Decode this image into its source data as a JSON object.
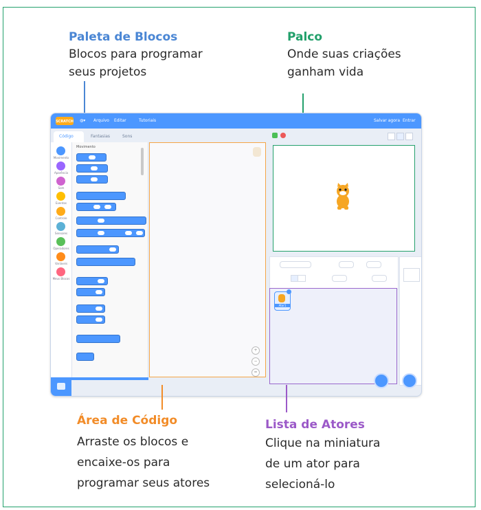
{
  "annotations": {
    "palette": {
      "title": "Paleta de Blocos",
      "desc_1": "Blocos para programar",
      "desc_2": "seus projetos",
      "color": "#4a86d4"
    },
    "stage": {
      "title": "Palco",
      "desc_1": "Onde suas criações",
      "desc_2": "ganham vida",
      "color": "#22a06b"
    },
    "code": {
      "title": "Área de Código",
      "desc_1": "Arraste os blocos e",
      "desc_2": "encaixe-os para",
      "desc_3": "programar seus atores",
      "color": "#f28c28"
    },
    "sprites": {
      "title": "Lista de Atores",
      "desc_1": "Clique na miniatura",
      "desc_2": "de um ator para",
      "desc_3": "selecioná-lo",
      "color": "#9b59c8"
    }
  },
  "editor": {
    "accent": "#4c97ff",
    "logo_text": "SCRATCH",
    "menu": {
      "file": "Arquivo",
      "edit": "Editar",
      "tutorials": "Tutoriais",
      "project": "Salvar agora",
      "user": "Entrar"
    },
    "tabs": {
      "code": "Código",
      "costumes": "Fantasias",
      "sounds": "Sons"
    },
    "palette_heading": "Movimento",
    "categories": [
      {
        "label": "Movimento",
        "color": "#4c97ff"
      },
      {
        "label": "Aparência",
        "color": "#9966ff"
      },
      {
        "label": "Som",
        "color": "#cf63cf"
      },
      {
        "label": "Eventos",
        "color": "#ffbf00"
      },
      {
        "label": "Controle",
        "color": "#ffab19"
      },
      {
        "label": "Sensores",
        "color": "#5cb1d6"
      },
      {
        "label": "Operadores",
        "color": "#59c059"
      },
      {
        "label": "Variáveis",
        "color": "#ff8c1a"
      },
      {
        "label": "Meus Blocos",
        "color": "#ff6680"
      }
    ],
    "sprite_thumb_label": "Ator1"
  }
}
